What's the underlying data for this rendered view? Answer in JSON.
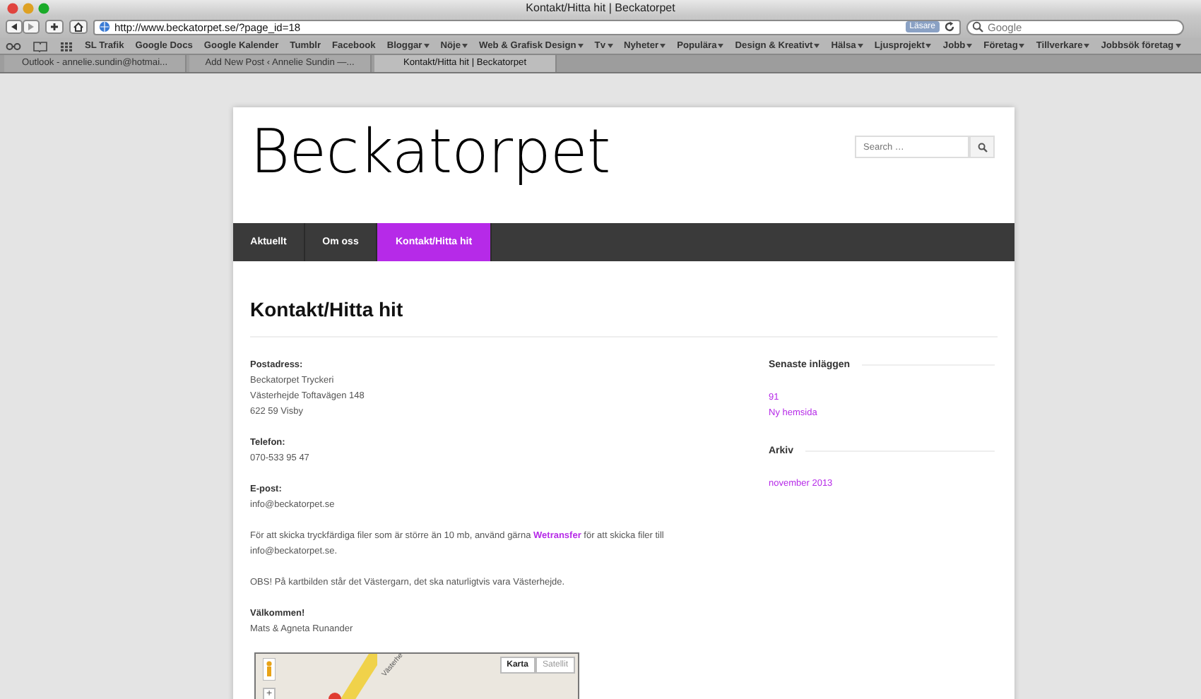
{
  "window": {
    "title": "Kontakt/Hitta hit | Beckatorpet"
  },
  "toolbar": {
    "url": "http://www.beckatorpet.se/?page_id=18",
    "reader_badge": "Läsare",
    "search_placeholder": "Google"
  },
  "bookmarks": [
    {
      "label": "SL Trafik",
      "menu": false
    },
    {
      "label": "Google Docs",
      "menu": false
    },
    {
      "label": "Google Kalender",
      "menu": false
    },
    {
      "label": "Tumblr",
      "menu": false
    },
    {
      "label": "Facebook",
      "menu": false
    },
    {
      "label": "Bloggar",
      "menu": true
    },
    {
      "label": "Nöje",
      "menu": true
    },
    {
      "label": "Web & Grafisk Design",
      "menu": true
    },
    {
      "label": "Tv",
      "menu": true
    },
    {
      "label": "Nyheter",
      "menu": true
    },
    {
      "label": "Populära",
      "menu": true
    },
    {
      "label": "Design & Kreativt",
      "menu": true
    },
    {
      "label": "Hälsa",
      "menu": true
    },
    {
      "label": "Ljusprojekt",
      "menu": true
    },
    {
      "label": "Jobb",
      "menu": true
    },
    {
      "label": "Företag",
      "menu": true
    },
    {
      "label": "Tillverkare",
      "menu": true
    },
    {
      "label": "Jobbsök företag",
      "menu": true
    }
  ],
  "tabs": [
    {
      "label": "Outlook - annelie.sundin@hotmai...",
      "selected": false
    },
    {
      "label": "Add New Post ‹ Annelie Sundin —...",
      "selected": false
    },
    {
      "label": "Kontakt/Hitta hit | Beckatorpet",
      "selected": true
    }
  ],
  "site": {
    "logo": "Beckatorpet",
    "search_placeholder": "Search …",
    "nav": [
      {
        "label": "Aktuellt",
        "selected": false
      },
      {
        "label": "Om oss",
        "selected": false
      },
      {
        "label": "Kontakt/Hitta hit",
        "selected": true
      }
    ],
    "page_title": "Kontakt/Hitta hit",
    "blocks": [
      {
        "heading": "Postadress:",
        "lines": [
          "Beckatorpet Tryckeri",
          "Västerhejde Toftavägen 148",
          "622 59 Visby"
        ]
      },
      {
        "heading": "Telefon:",
        "lines": [
          "070-533 95 47"
        ]
      },
      {
        "heading": "E-post:",
        "lines": [
          "info@beckatorpet.se"
        ]
      },
      {
        "lines": [
          "För att skicka tryckfärdiga filer som är större än 10 mb, använd gärna **Wetransfer** för att skicka filer till info@beckatorpet.se."
        ]
      },
      {
        "lines": [
          "OBS! På kartbilden står det Västergarn, det ska naturligtvis vara Västerhejde."
        ]
      },
      {
        "heading": "Välkommen!",
        "lines": [
          "Mats & Agneta Runander"
        ]
      }
    ],
    "map": {
      "road_label": "Västerhe",
      "buttons": [
        {
          "label": "Karta",
          "selected": true
        },
        {
          "label": "Satellit",
          "selected": false
        }
      ],
      "zoom_in": "+"
    },
    "sidebar": [
      {
        "title": "Senaste inläggen",
        "links": [
          "91",
          "Ny hemsida"
        ]
      },
      {
        "title": "Arkiv",
        "links": [
          "november 2013"
        ]
      }
    ]
  }
}
